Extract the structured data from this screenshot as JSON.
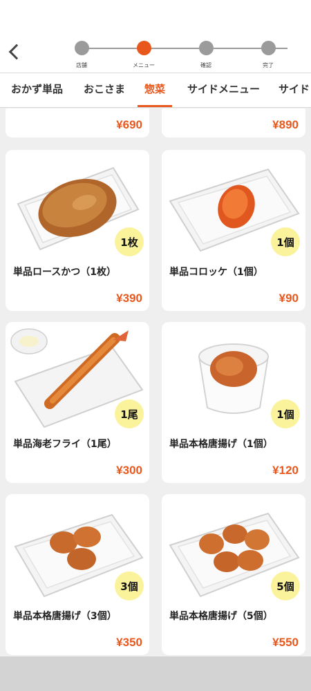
{
  "progress": {
    "steps": [
      {
        "label": "店舗",
        "active": false
      },
      {
        "label": "メニュー",
        "active": true
      },
      {
        "label": "確認",
        "active": false
      },
      {
        "label": "完了",
        "active": false
      }
    ]
  },
  "tabs": [
    {
      "label": "おかず単品",
      "active": false
    },
    {
      "label": "おこさま",
      "active": false
    },
    {
      "label": "惣菜",
      "active": true
    },
    {
      "label": "サイドメニュー",
      "active": false
    },
    {
      "label": "サイド",
      "active": false
    }
  ],
  "partial_row": {
    "left_price": "¥690",
    "right_price": "¥890"
  },
  "products": [
    {
      "name": "単品ロースかつ（1枚）",
      "price": "¥390",
      "badge": "1枚",
      "image": "pork-cutlet-tray"
    },
    {
      "name": "単品コロッケ（1個）",
      "price": "¥90",
      "badge": "1個",
      "image": "croquette-tray"
    },
    {
      "name": "単品海老フライ（1尾）",
      "price": "¥300",
      "badge": "1尾",
      "image": "fried-shrimp-tray"
    },
    {
      "name": "単品本格唐揚げ（1個）",
      "price": "¥120",
      "badge": "1個",
      "image": "karaage-cup"
    },
    {
      "name": "単品本格唐揚げ（3個）",
      "price": "¥350",
      "badge": "3個",
      "image": "karaage-tray-3"
    },
    {
      "name": "単品本格唐揚げ（5個）",
      "price": "¥550",
      "badge": "5個",
      "image": "karaage-tray-5"
    }
  ],
  "colors": {
    "accent": "#e8571c",
    "badge": "#fbf29c",
    "inactive_step": "#9b9b9b"
  }
}
